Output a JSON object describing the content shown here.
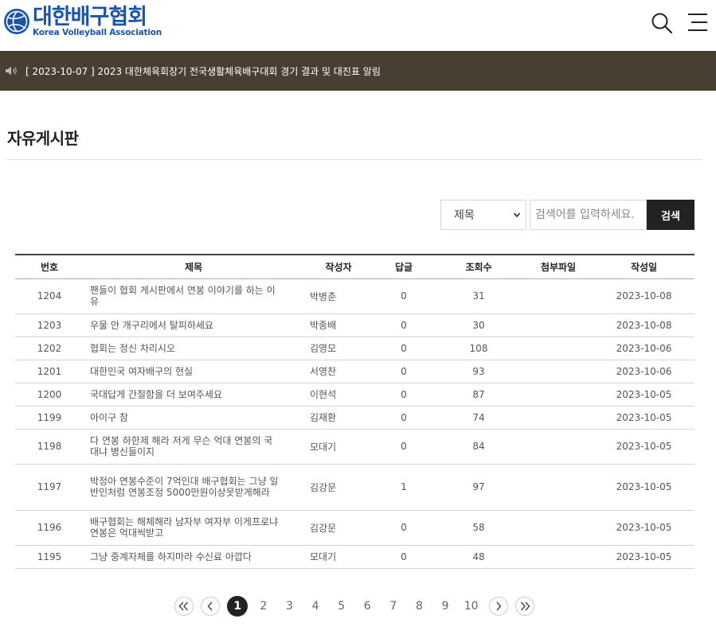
{
  "header": {
    "logo_kr": "대한배구협회",
    "logo_en": "Korea Volleyball Association"
  },
  "notice": {
    "text": "[ 2023-10-07 ] 2023 대한체육회장기 전국생활체육배구대회 경기 결과 및 대진표 알림"
  },
  "page_title": "자유게시판",
  "search": {
    "select_value": "제목",
    "placeholder": "검색어를 입력하세요.",
    "button_label": "검색"
  },
  "table": {
    "columns": [
      "번호",
      "제목",
      "작성자",
      "답글",
      "조회수",
      "첨부파일",
      "작성일"
    ],
    "rows": [
      {
        "no": "1204",
        "title": "팬들이 협회 게시판에서 연봉 이야기를 하는 이유",
        "author": "박병춘",
        "replies": "0",
        "views": "31",
        "file": "",
        "date": "2023-10-08"
      },
      {
        "no": "1203",
        "title": "우물 안 개구리에서 탈피하세요",
        "author": "박종배",
        "replies": "0",
        "views": "30",
        "file": "",
        "date": "2023-10-08"
      },
      {
        "no": "1202",
        "title": "협회는 정신 차리시오",
        "author": "김영모",
        "replies": "0",
        "views": "108",
        "file": "",
        "date": "2023-10-06"
      },
      {
        "no": "1201",
        "title": "대한민국 여자배구의 현실",
        "author": "서영찬",
        "replies": "0",
        "views": "93",
        "file": "",
        "date": "2023-10-06"
      },
      {
        "no": "1200",
        "title": "국대답게 간절함을 더 보여주세요",
        "author": "이현석",
        "replies": "0",
        "views": "87",
        "file": "",
        "date": "2023-10-05"
      },
      {
        "no": "1199",
        "title": "아이구 참",
        "author": "김재환",
        "replies": "0",
        "views": "74",
        "file": "",
        "date": "2023-10-05"
      },
      {
        "no": "1198",
        "title": "다 연봉 하한제 해라 저게 무슨 억대 연봉의 국대냐 병신들이지",
        "author": "모대기",
        "replies": "0",
        "views": "84",
        "file": "",
        "date": "2023-10-05"
      },
      {
        "no": "1197",
        "title": "박정아 연봉수준이 7억인대 배구협회는 그냥 일반인처럼 연봉조정 5000만원이상못받게해라",
        "author": "김강문",
        "replies": "1",
        "views": "97",
        "file": "",
        "date": "2023-10-05"
      },
      {
        "no": "1196",
        "title": "배구협회는 해체해라 남자부 여자부 이게프로냐 연봉은 억대씩받고",
        "author": "김강문",
        "replies": "0",
        "views": "58",
        "file": "",
        "date": "2023-10-05"
      },
      {
        "no": "1195",
        "title": "그냥 중계자체를 하지마라 수신료 아깝다",
        "author": "모대기",
        "replies": "0",
        "views": "48",
        "file": "",
        "date": "2023-10-05"
      }
    ]
  },
  "pagination": {
    "pages": [
      "1",
      "2",
      "3",
      "4",
      "5",
      "6",
      "7",
      "8",
      "9",
      "10"
    ],
    "current": "1"
  },
  "colors": {
    "brand_blue": "#1a55a8",
    "notice_bg": "#483f33",
    "button_dark": "#222222"
  }
}
